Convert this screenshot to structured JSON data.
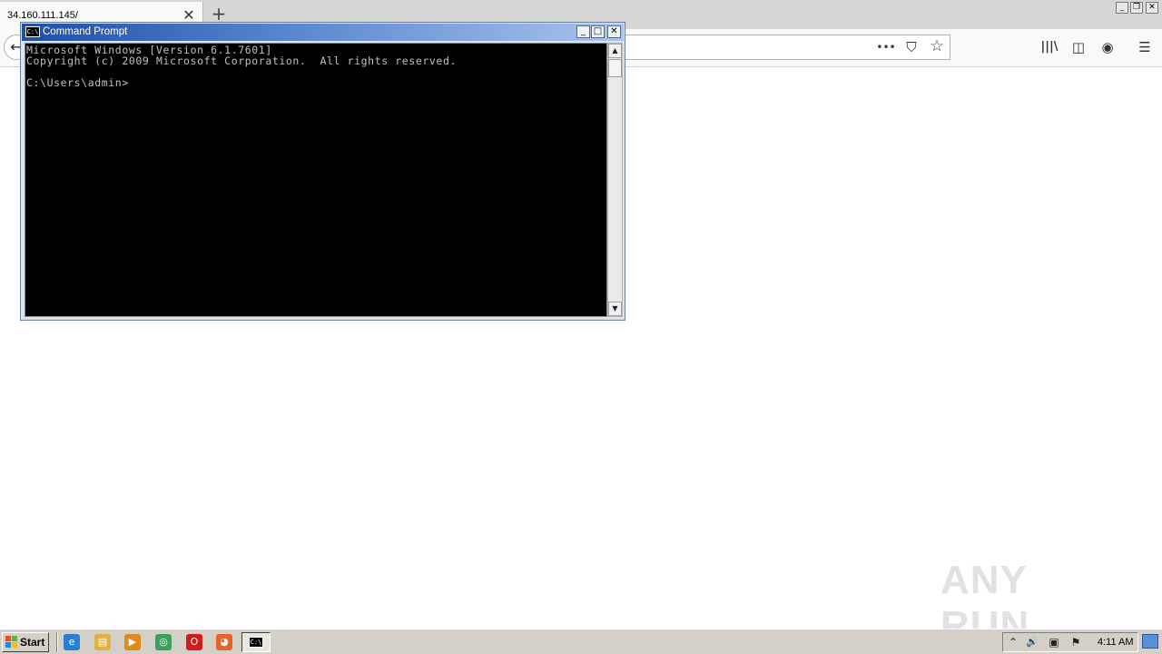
{
  "browser": {
    "tab_title": "34.160.111.145/",
    "tab_close_glyph": "✕",
    "new_tab_glyph": "+",
    "back_glyph": "←",
    "page_actions_glyph": "•••",
    "pocket_glyph": "⛉",
    "bookmark_glyph": "☆",
    "library_glyph": "|||\\",
    "sidebar_glyph": "◫",
    "account_glyph": "◉",
    "menu_glyph": "☰",
    "window_controls": {
      "minimize": "_",
      "restore": "❐",
      "close": "✕"
    }
  },
  "cmd": {
    "title": "Command Prompt",
    "icon_text": "C:\\",
    "controls": {
      "minimize": "_",
      "maximize": "□",
      "close": "✕"
    },
    "lines": [
      "Microsoft Windows [Version 6.1.7601]",
      "Copyright (c) 2009 Microsoft Corporation.  All rights reserved.",
      "",
      "C:\\Users\\admin>"
    ],
    "scroll_up_glyph": "▲",
    "scroll_down_glyph": "▼"
  },
  "watermark": {
    "text": "ANY RUN"
  },
  "taskbar": {
    "start_label": "Start",
    "quick_launch": [
      {
        "icon": "internet-explorer-icon",
        "glyph": "e",
        "color": "#2a7fd4"
      },
      {
        "icon": "file-explorer-icon",
        "glyph": "▤",
        "color": "#e0b040"
      },
      {
        "icon": "media-player-icon",
        "glyph": "▶",
        "color": "#e08a1e"
      },
      {
        "icon": "chrome-icon",
        "glyph": "◎",
        "color": "#3aa057"
      },
      {
        "icon": "opera-icon",
        "glyph": "O",
        "color": "#d21b1b"
      },
      {
        "icon": "firefox-icon",
        "glyph": "◕",
        "color": "#e8602c"
      }
    ],
    "active_task_icon_text": "C:\\",
    "clock": "4:11 AM",
    "tray_glyphs": {
      "arrow": "⌃",
      "volume": "🔊",
      "network": "▣",
      "flag": "⚑"
    }
  }
}
